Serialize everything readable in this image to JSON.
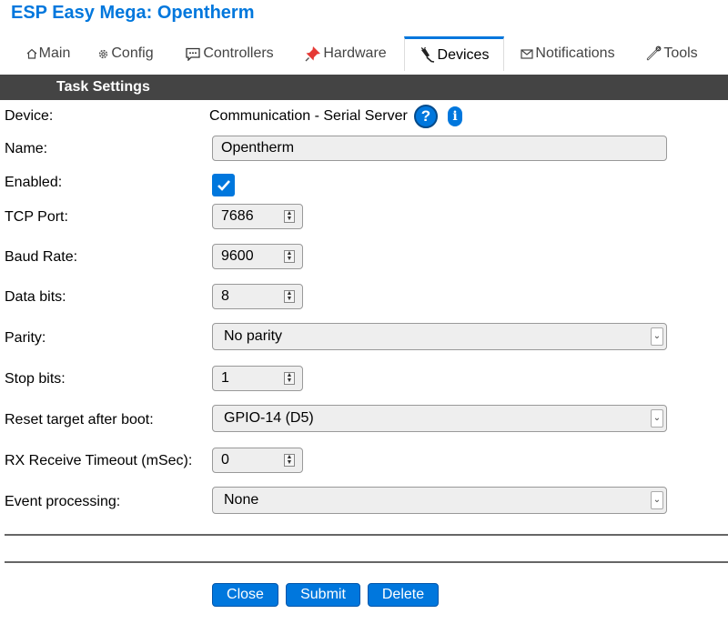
{
  "app_title": "ESP Easy Mega: Opentherm",
  "tabs": [
    {
      "label": "Main",
      "icon": "home-icon"
    },
    {
      "label": "Config",
      "icon": "gear-icon"
    },
    {
      "label": "Controllers",
      "icon": "chat-icon"
    },
    {
      "label": "Hardware",
      "icon": "pin-icon"
    },
    {
      "label": "Devices",
      "icon": "plug-icon",
      "active": true
    },
    {
      "label": "Notifications",
      "icon": "envelope-icon"
    },
    {
      "label": "Tools",
      "icon": "wrench-icon"
    }
  ],
  "section_title": "Task Settings",
  "form": {
    "device": {
      "label": "Device:",
      "value": "Communication - Serial Server",
      "help_icon": "?",
      "info_icon": "i"
    },
    "name": {
      "label": "Name:",
      "value": "Opentherm"
    },
    "enabled": {
      "label": "Enabled:",
      "checked": true
    },
    "tcp_port": {
      "label": "TCP Port:",
      "value": "7686"
    },
    "baud_rate": {
      "label": "Baud Rate:",
      "value": "9600"
    },
    "data_bits": {
      "label": "Data bits:",
      "value": "8"
    },
    "parity": {
      "label": "Parity:",
      "value": "No parity"
    },
    "stop_bits": {
      "label": "Stop bits:",
      "value": "1"
    },
    "reset_target": {
      "label": "Reset target after boot:",
      "value": "GPIO-14 (D5)"
    },
    "rx_timeout": {
      "label": "RX Receive Timeout (mSec):",
      "value": "0"
    },
    "event_processing": {
      "label": "Event processing:",
      "value": "None"
    }
  },
  "buttons": {
    "close": "Close",
    "submit": "Submit",
    "delete": "Delete"
  },
  "colors": {
    "accent": "#0077dd",
    "section_bar": "#444444"
  }
}
